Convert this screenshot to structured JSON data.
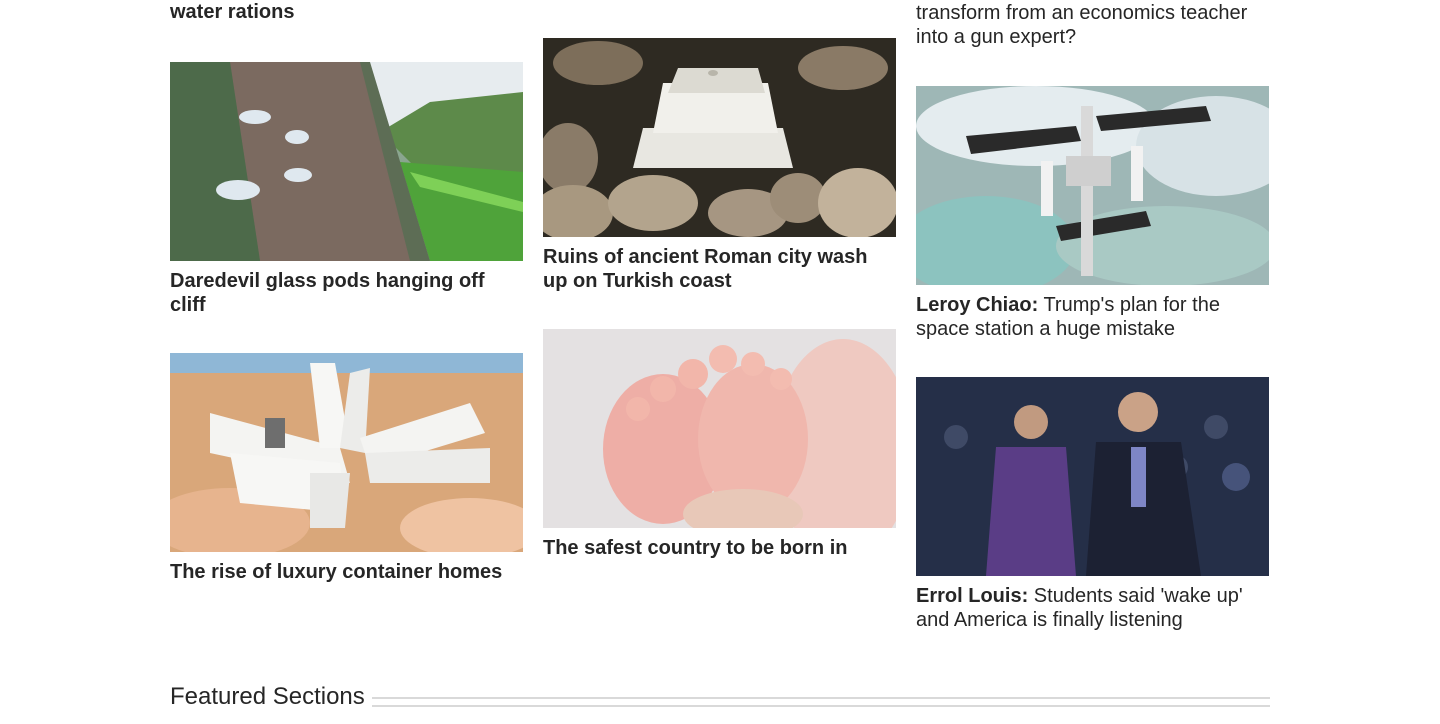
{
  "top_fragments": {
    "left": "water rations",
    "right": "transform from an economics teacher into a gun expert?"
  },
  "cards": {
    "pods": {
      "title": "Daredevil glass pods hanging off cliff",
      "image_alt": "glass pods on cliff face above green valley"
    },
    "roman": {
      "title": "Ruins of ancient Roman city wash up on Turkish coast",
      "image_alt": "white marble column base among rocks and water"
    },
    "station": {
      "author": "Leroy Chiao:",
      "title": "Trump's plan for the space station a huge mistake",
      "image_alt": "space station above Earth"
    },
    "containers": {
      "title": "The rise of luxury container homes",
      "image_alt": "white shipping container house in desert"
    },
    "baby": {
      "title": "The safest country to be born in",
      "image_alt": "baby feet in hand"
    },
    "rubio": {
      "author": "Errol Louis:",
      "title": "Students said 'wake up' and America is finally listening",
      "image_alt": "student speaking to senator at town hall"
    }
  },
  "featured": {
    "title": "Featured Sections"
  }
}
